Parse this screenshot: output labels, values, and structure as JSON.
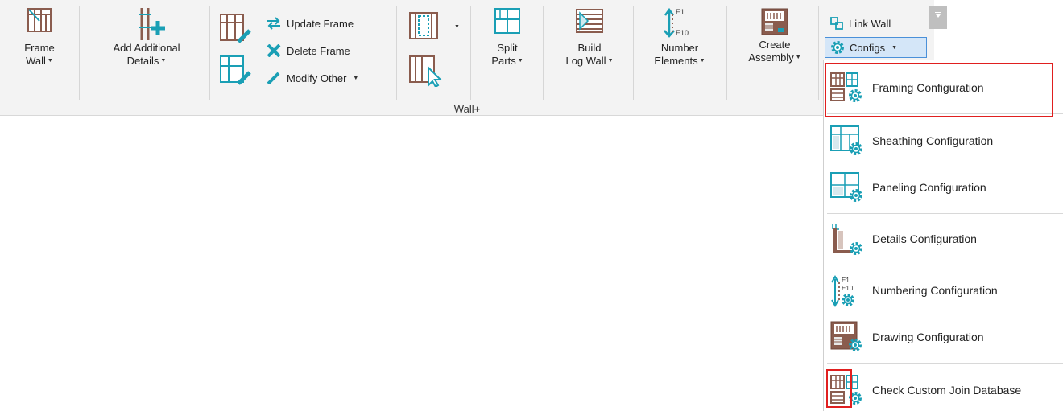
{
  "ribbon": {
    "group_label": "Wall+",
    "buttons": {
      "frame_wall": [
        "Frame",
        "Wall"
      ],
      "add_additional_details": [
        "Add Additional",
        "Details"
      ],
      "update_frame": "Update Frame",
      "delete_frame": "Delete Frame",
      "modify_other": "Modify Other",
      "split_parts": [
        "Split",
        "Parts"
      ],
      "build_log_wall": [
        "Build",
        "Log Wall"
      ],
      "number_elements": [
        "Number",
        "Elements"
      ],
      "number_icon_top": "E1",
      "number_icon_bottom": "E10",
      "create_assembly": [
        "Create",
        "Assembly"
      ],
      "link_wall": "Link Wall",
      "configs": "Configs"
    }
  },
  "menu": {
    "items": [
      {
        "label": "Framing Configuration",
        "icon": "framing-config-icon"
      },
      {
        "label": "Sheathing Configuration",
        "icon": "sheathing-config-icon"
      },
      {
        "label": "Paneling Configuration",
        "icon": "paneling-config-icon"
      },
      {
        "label": "Details Configuration",
        "icon": "details-config-icon"
      },
      {
        "label": "Numbering Configuration",
        "icon": "numbering-config-icon"
      },
      {
        "label": "Drawing Configuration",
        "icon": "drawing-config-icon"
      },
      {
        "label": "Check Custom Join Database",
        "icon": "check-join-db-icon"
      }
    ]
  },
  "colors": {
    "teal": "#1a9fb5",
    "brown": "#8a5c4e",
    "highlight": "#e01f1f",
    "selected_bg": "#d4e6f8"
  }
}
